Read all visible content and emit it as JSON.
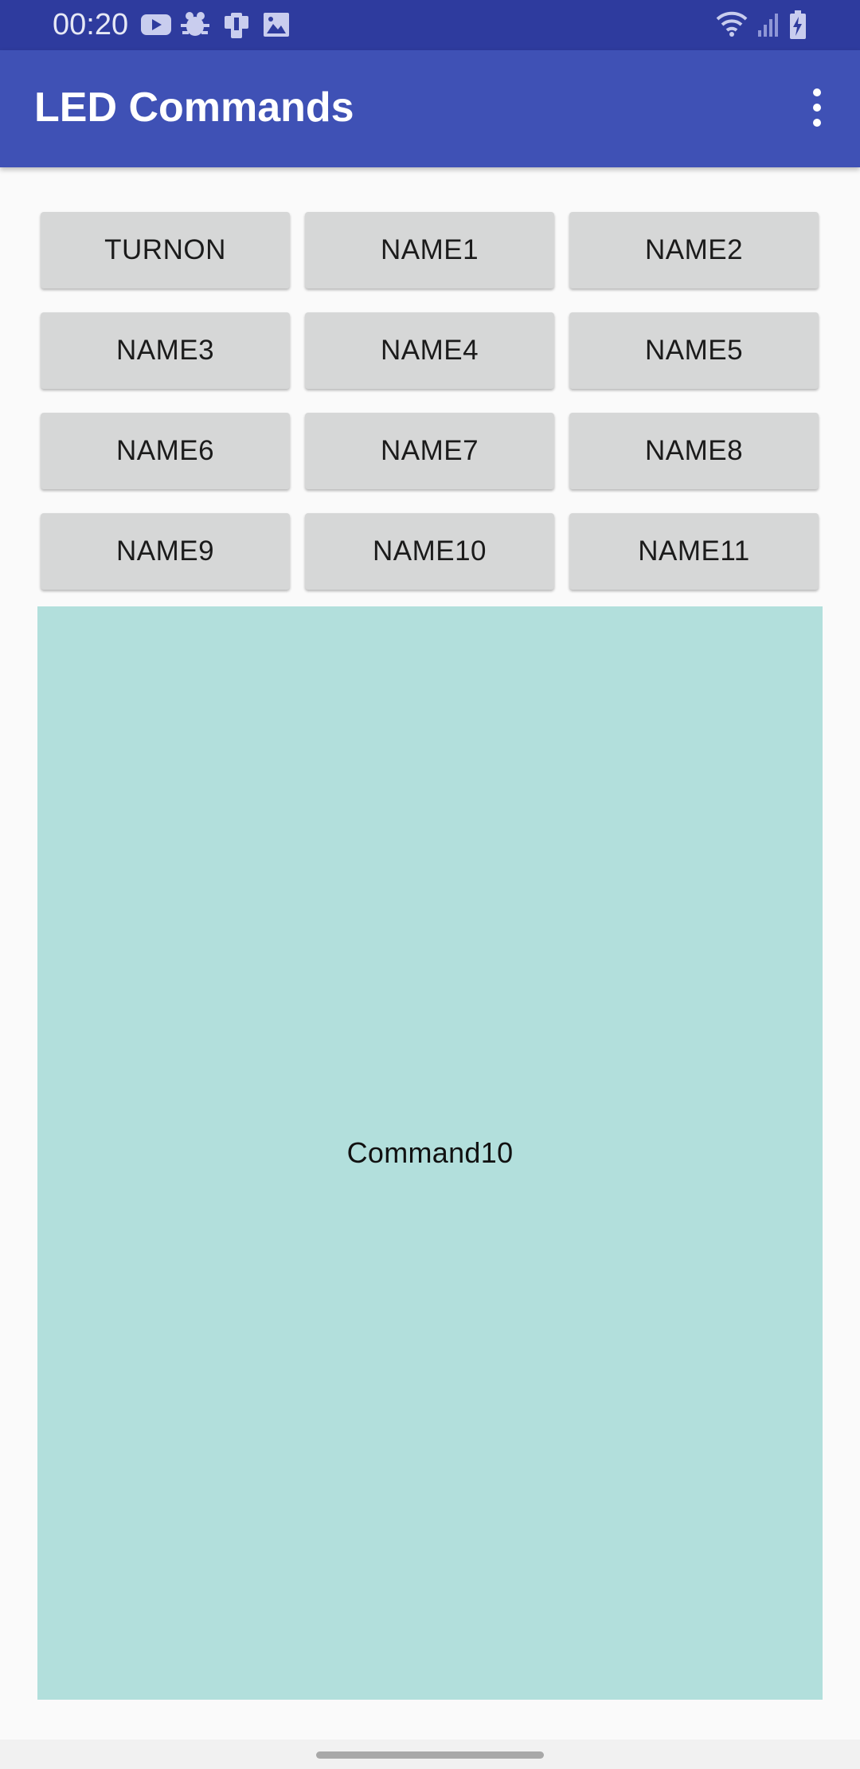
{
  "status_bar": {
    "time": "00:20",
    "background_color": "#2e3b9e",
    "left_icons": [
      "youtube-icon",
      "bug-icon",
      "phone-icon",
      "image-icon"
    ],
    "right_icons": [
      "wifi-icon",
      "signal-icon",
      "battery-charging-icon"
    ]
  },
  "app_bar": {
    "title": "LED Commands",
    "background_color": "#3f51b5",
    "menu_icon": "overflow-menu-icon"
  },
  "buttons": [
    {
      "label": "TURNON"
    },
    {
      "label": "NAME1"
    },
    {
      "label": "NAME2"
    },
    {
      "label": "NAME3"
    },
    {
      "label": "NAME4"
    },
    {
      "label": "NAME5"
    },
    {
      "label": "NAME6"
    },
    {
      "label": "NAME7"
    },
    {
      "label": "NAME8"
    },
    {
      "label": "NAME9"
    },
    {
      "label": "NAME10"
    },
    {
      "label": "NAME11"
    }
  ],
  "display": {
    "text": "Command10",
    "background_color": "#b2dfdc"
  }
}
